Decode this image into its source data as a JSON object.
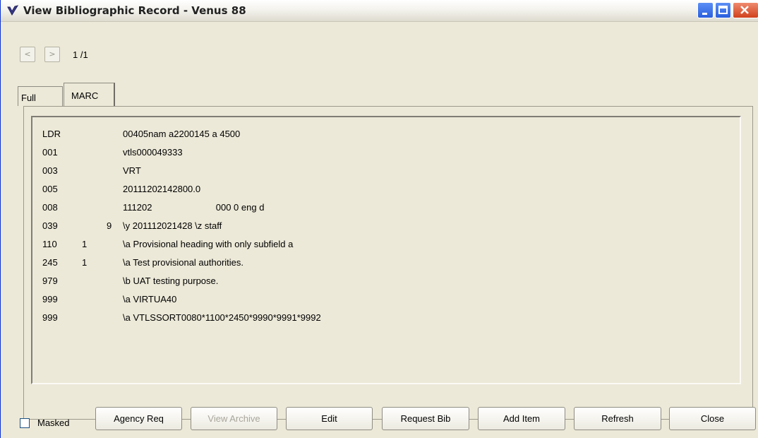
{
  "window": {
    "title": "View Bibliographic Record - Venus 88",
    "icon": "check-v-icon"
  },
  "nav": {
    "prev_label": "<",
    "next_label": ">",
    "pager": "1 /1"
  },
  "tabs": [
    {
      "label": "Full",
      "selected": false
    },
    {
      "label": "MARC",
      "selected": true
    }
  ],
  "marc": [
    {
      "tag": "LDR",
      "ind1": "",
      "ind2": "",
      "data": "00405nam a2200145 a 4500"
    },
    {
      "tag": "001",
      "ind1": "",
      "ind2": "",
      "data": "vtls000049333"
    },
    {
      "tag": "003",
      "ind1": "",
      "ind2": "",
      "data": "VRT"
    },
    {
      "tag": "005",
      "ind1": "",
      "ind2": "",
      "data": "20111202142800.0"
    },
    {
      "tag": "008",
      "ind1": "",
      "ind2": "",
      "data": "111202                         000 0 eng d"
    },
    {
      "tag": "039",
      "ind1": "",
      "ind2": "9",
      "data": "\\y 201112021428 \\z staff"
    },
    {
      "tag": "110",
      "ind1": "1",
      "ind2": "",
      "data": "\\a Provisional heading with only subfield a"
    },
    {
      "tag": "245",
      "ind1": "1",
      "ind2": "",
      "data": "\\a Test provisional authorities."
    },
    {
      "tag": "979",
      "ind1": "",
      "ind2": "",
      "data": "\\b UAT testing purpose."
    },
    {
      "tag": "999",
      "ind1": "",
      "ind2": "",
      "data": "\\a VIRTUA40"
    },
    {
      "tag": "999",
      "ind1": "",
      "ind2": "",
      "data": "\\a VTLSSORT0080*1100*2450*9990*9991*9992"
    }
  ],
  "footer": {
    "masked_label": "Masked",
    "masked_checked": false,
    "buttons": [
      {
        "label": "Agency Req",
        "enabled": true
      },
      {
        "label": "View Archive",
        "enabled": false
      },
      {
        "label": "Edit",
        "enabled": true
      },
      {
        "label": "Request Bib",
        "enabled": true
      },
      {
        "label": "Add Item",
        "enabled": true
      },
      {
        "label": "Refresh",
        "enabled": true
      },
      {
        "label": "Close",
        "enabled": true
      }
    ]
  },
  "colors": {
    "window_bg": "#ece9d8",
    "title_text": "#222222",
    "close_button": "#d1411d",
    "min_max_button": "#2a5fdd",
    "disabled_text": "#a8a69b"
  }
}
